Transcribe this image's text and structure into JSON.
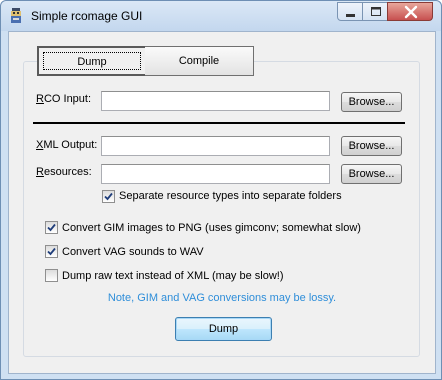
{
  "window": {
    "title": "Simple rcomage GUI",
    "icon": "rcomage-app-icon"
  },
  "title_controls": {
    "minimize_icon": "minimize-icon",
    "maximize_icon": "maximize-icon",
    "close_icon": "close-icon"
  },
  "tabs": [
    {
      "label": "Dump",
      "selected": true
    },
    {
      "label": "Compile",
      "selected": false
    }
  ],
  "fields": {
    "rco_input": {
      "label": "RCO Input:",
      "mnemonic": "R",
      "rest": "CO Input:",
      "value": ""
    },
    "xml_output": {
      "label": "XML Output:",
      "mnemonic": "X",
      "rest": "ML Output:",
      "value": ""
    },
    "resources": {
      "label": "Resources:",
      "mnemonic": "R",
      "rest": "esources:",
      "value": ""
    }
  },
  "browse_label": "Browse...",
  "options": {
    "separate_resources": {
      "label": "Separate resource types into separate folders",
      "checked": true
    },
    "convert_gim": {
      "label": "Convert GIM images to PNG (uses gimconv; somewhat slow)",
      "checked": true
    },
    "convert_vag": {
      "label": "Convert VAG sounds to WAV",
      "checked": true
    },
    "dump_raw_text": {
      "label": "Dump raw text instead of XML (may be slow!)",
      "checked": false
    }
  },
  "note": "Note, GIM and VAG conversions may be lossy.",
  "dump_button": "Dump",
  "colors": {
    "note_text": "#2f8ed9",
    "close_button": "#c75050"
  }
}
